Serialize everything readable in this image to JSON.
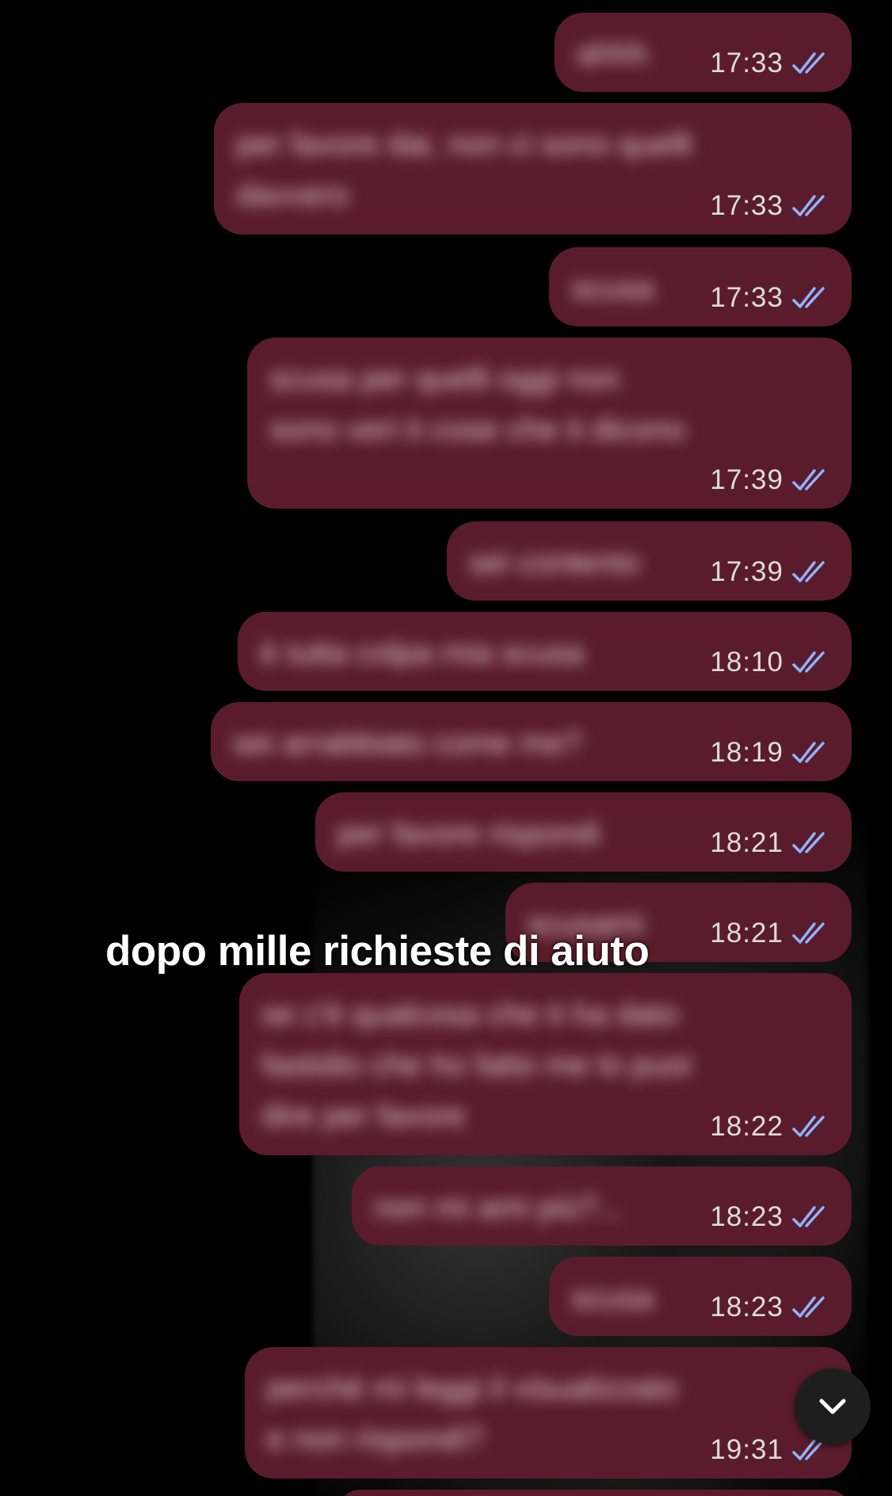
{
  "messages": [
    {
      "text": "ahhh",
      "time": "17:33",
      "status": "read"
    },
    {
      "text": "per favore dai, non ci sono quelli davvero",
      "time": "17:33",
      "status": "read"
    },
    {
      "text": "scusa",
      "time": "17:33",
      "status": "read"
    },
    {
      "text": "scusa per quelli oggi non sono veri ti cose che ti dicono",
      "time": "17:39",
      "status": "read"
    },
    {
      "text": "sei contento",
      "time": "17:39",
      "status": "read"
    },
    {
      "text": "è tutta colpa mia scusa",
      "time": "18:10",
      "status": "read"
    },
    {
      "text": "sei arrabbiato come me?",
      "time": "18:19",
      "status": "read"
    },
    {
      "text": "per favore rispondi",
      "time": "18:21",
      "status": "read"
    },
    {
      "text": "scusami",
      "time": "18:21",
      "status": "read"
    },
    {
      "text": "se c'è qualcosa che ti ha dato fastidio che ho fatto me lo puoi dire per favore",
      "time": "18:22",
      "status": "read"
    },
    {
      "text": "non mi ami più?...",
      "time": "18:23",
      "status": "read"
    },
    {
      "text": "scusa",
      "time": "18:23",
      "status": "read"
    },
    {
      "text": "perché mi leggi il visualizzato e non rispondi?",
      "time": "19:31",
      "status": "read"
    }
  ],
  "overlay_caption": "dopo mille richieste di aiuto",
  "scroll_button_icon": "chevron-down-icon",
  "colors": {
    "bubble": "#5a1c2c",
    "background": "#000000",
    "read_ticks": "#8fb4ff",
    "time_text": "#dddcdc"
  }
}
